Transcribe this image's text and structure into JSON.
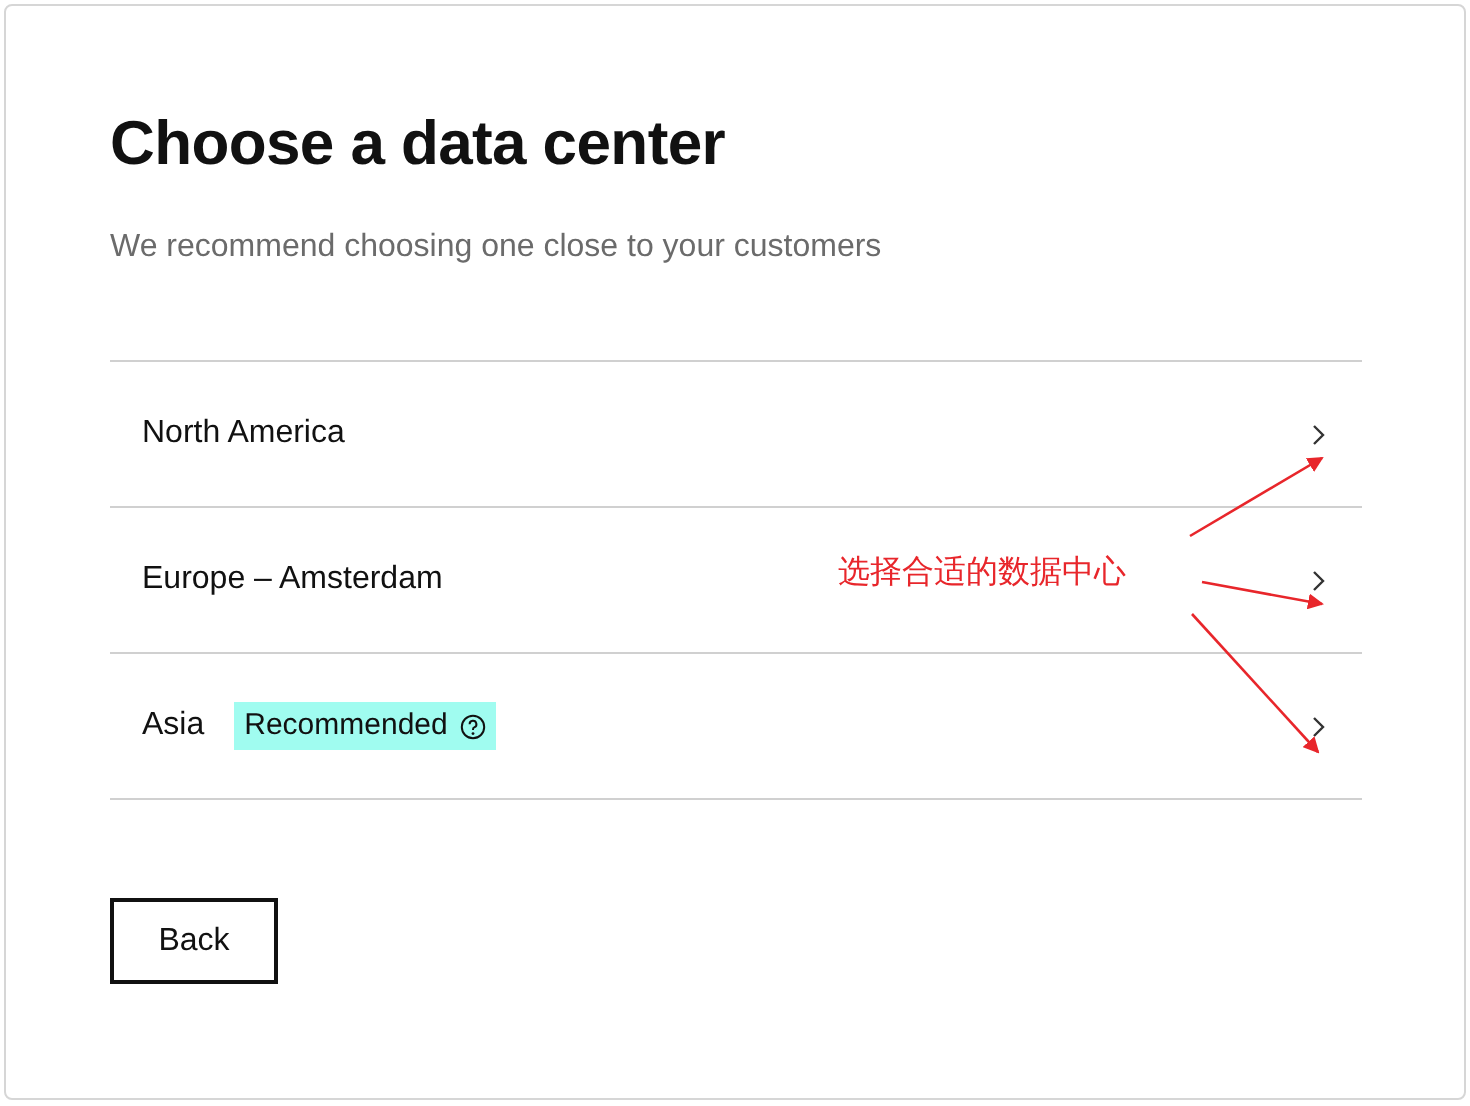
{
  "title": "Choose a data center",
  "subtitle": "We recommend choosing one close to your customers",
  "regions": [
    {
      "name": "North America"
    },
    {
      "name": "Europe – Amsterdam"
    },
    {
      "name": "Asia",
      "badge": "Recommended"
    }
  ],
  "back_button": "Back",
  "annotation": {
    "text": "选择合适的数据中心"
  }
}
